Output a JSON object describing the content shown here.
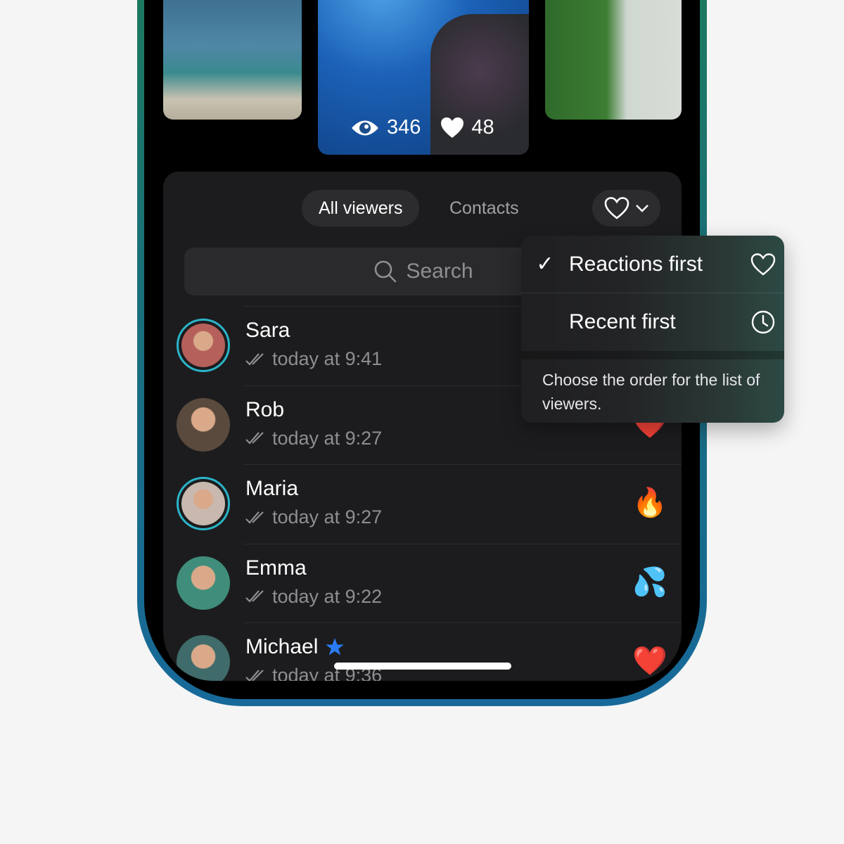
{
  "story": {
    "views": "346",
    "likes": "48"
  },
  "tabs": {
    "all_viewers": "All viewers",
    "contacts": "Contacts"
  },
  "search": {
    "placeholder": "Search"
  },
  "viewers": [
    {
      "name": "Sara",
      "time": "today at 9:41",
      "reaction": "",
      "ring": true,
      "color": "#b5605a"
    },
    {
      "name": "Rob",
      "time": "today at 9:27",
      "reaction": "❤️",
      "ring": false,
      "color": "#5a4a3e"
    },
    {
      "name": "Maria",
      "time": "today at 9:27",
      "reaction": "🔥",
      "ring": true,
      "color": "#c8b8ae"
    },
    {
      "name": "Emma",
      "time": "today at 9:22",
      "reaction": "💦",
      "ring": false,
      "color": "#3f8d7a"
    },
    {
      "name": "Michael",
      "time": "today at 9:36",
      "reaction": "❤️",
      "ring": false,
      "premium": true,
      "color": "#3f6b6a"
    }
  ],
  "sort_menu": {
    "options": [
      {
        "label": "Reactions first",
        "checked": true,
        "icon": "heart-icon"
      },
      {
        "label": "Recent first",
        "checked": false,
        "icon": "clock-icon"
      }
    ],
    "hint": "Choose the order for the list of viewers."
  },
  "colors": {
    "accent_ring": "#2bb4c8",
    "premium_star": "#2a7cf6",
    "heart": "#ff3b30"
  }
}
